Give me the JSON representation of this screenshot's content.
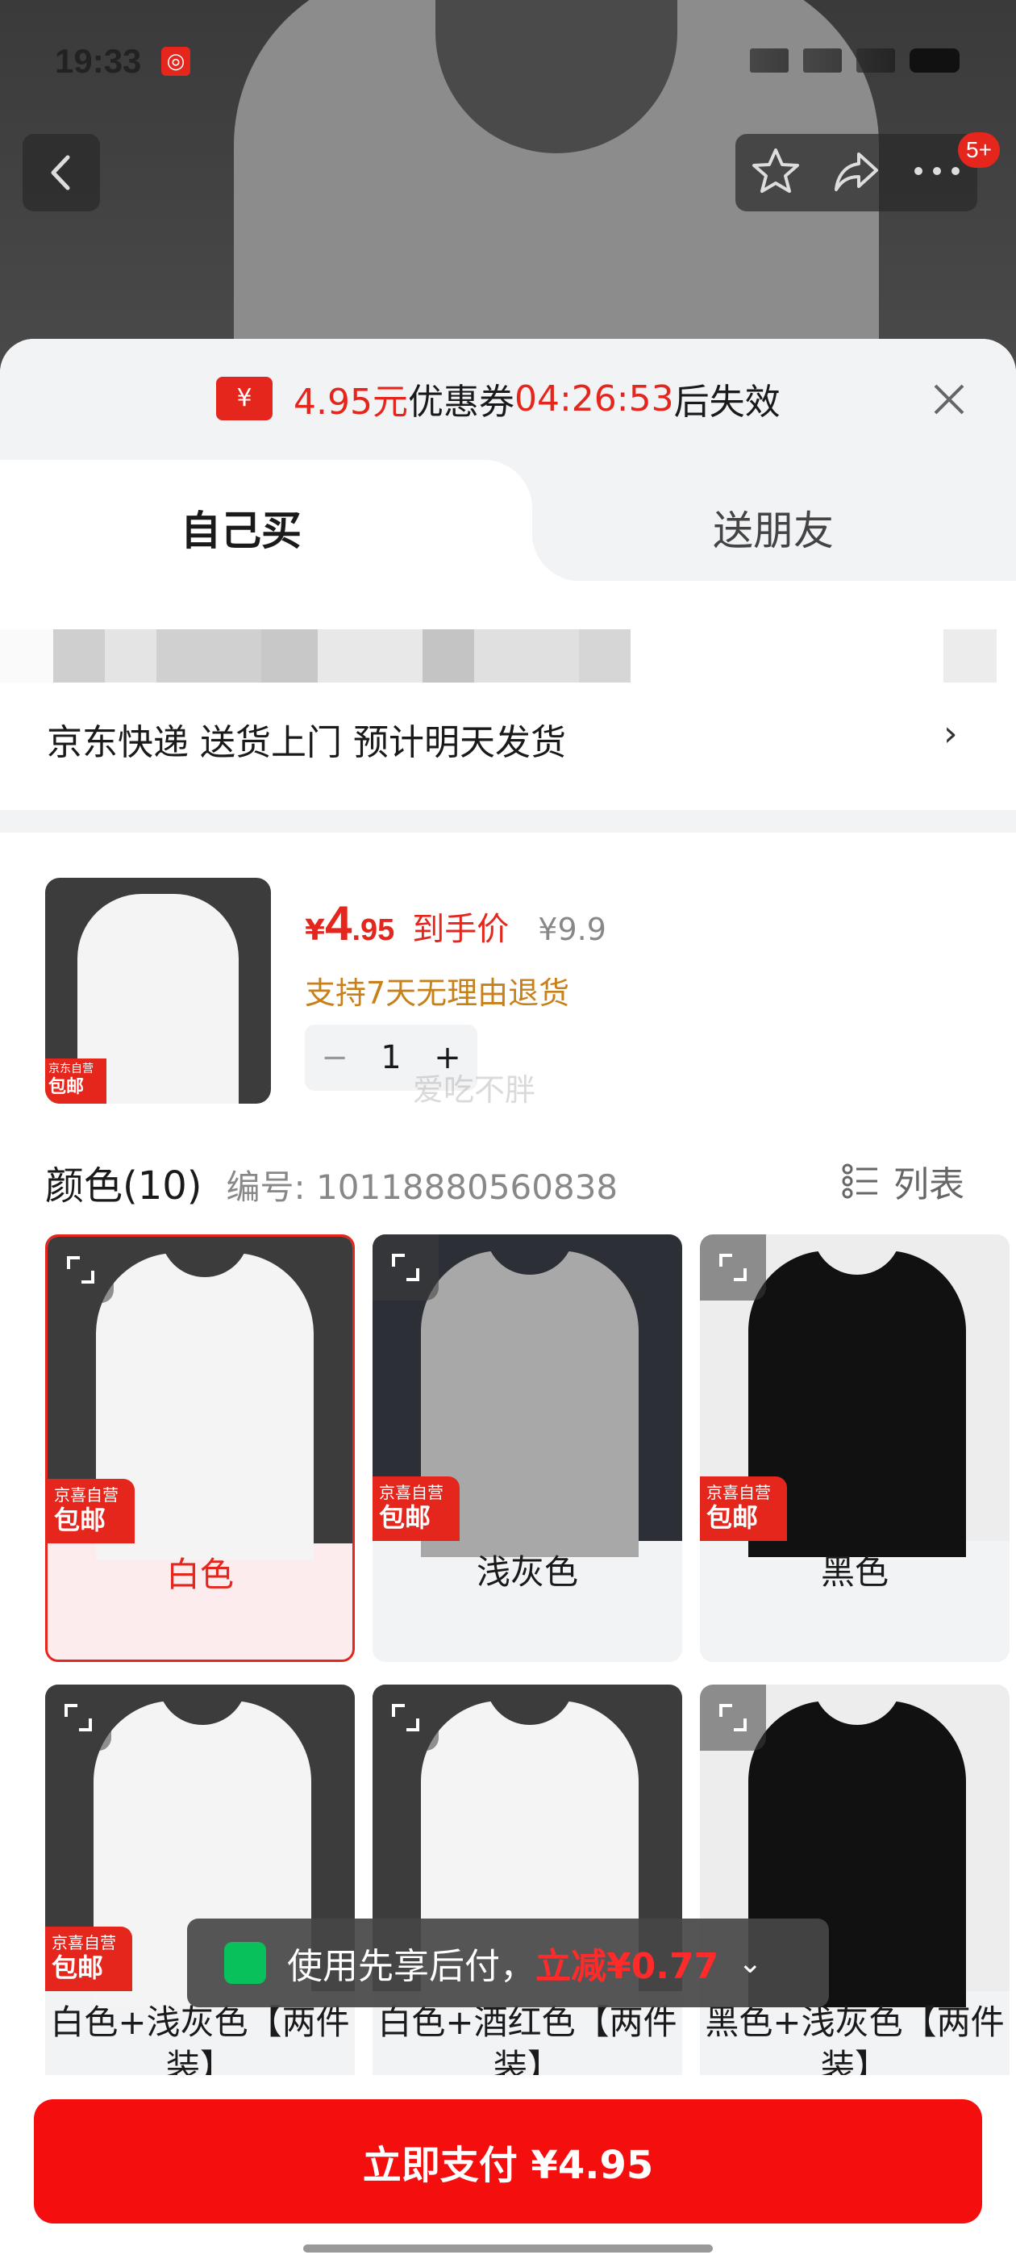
{
  "status_bar": {
    "time": "19:33",
    "app_icon": "netease-music-icon"
  },
  "header": {
    "back_icon": "chevron-left-icon",
    "fav_icon": "star-icon",
    "share_icon": "share-icon",
    "more_icon": "more-icon",
    "more_badge": "5+"
  },
  "coupon": {
    "amount": "4.95元",
    "label": "优惠券",
    "countdown": "04:26:53",
    "suffix": "后失效",
    "icon": "¥"
  },
  "tabs": [
    {
      "label": "自己买",
      "active": true
    },
    {
      "label": "送朋友",
      "active": false
    }
  ],
  "shipping": {
    "text": "京东快递 送货上门 预计明天发货",
    "arrow": "›"
  },
  "product": {
    "price_symbol": "¥",
    "price_int": "4",
    "price_dec": ".95",
    "price_tag": "到手价",
    "original_price": "¥9.9",
    "return_policy": "支持7天无理由退货",
    "quantity": "1",
    "minus": "−",
    "plus": "+",
    "badge_top": "京东自营",
    "badge_bottom": "包邮",
    "watermark": "爱吃不胖"
  },
  "color_section": {
    "title": "颜色(10)",
    "code": "编号: 10118880560838",
    "list_label": "列表"
  },
  "color_options": [
    {
      "label": "白色",
      "selected": true,
      "shirt": "#f4f4f4",
      "bg": "#3c3c3c",
      "badge_top": "京喜自营",
      "badge_bottom": "包邮"
    },
    {
      "label": "浅灰色",
      "selected": false,
      "shirt": "#a8a8a8",
      "bg": "#2c2f36",
      "badge_top": "京喜自营",
      "badge_bottom": "包邮"
    },
    {
      "label": "黑色",
      "selected": false,
      "shirt": "#111111",
      "bg": "#ededed",
      "badge_top": "京喜自营",
      "badge_bottom": "包邮"
    },
    {
      "label": "白色+浅灰色【两件装】",
      "selected": false,
      "shirt": "#f4f4f4",
      "bg": "#3c3c3c",
      "badge_top": "京喜自营",
      "badge_bottom": "包邮"
    },
    {
      "label": "白色+酒红色【两件装】",
      "selected": false,
      "shirt": "#f4f4f4",
      "bg": "#3c3c3c",
      "badge_top": "",
      "badge_bottom": ""
    },
    {
      "label": "黑色+浅灰色【两件装】",
      "selected": false,
      "shirt": "#111111",
      "bg": "#ededed",
      "badge_top": "",
      "badge_bottom": ""
    }
  ],
  "toast": {
    "text": "使用先享后付，",
    "highlight": "立减¥0.77"
  },
  "pay_button": {
    "label": "立即支付 ¥4.95"
  },
  "colors": {
    "accent": "#e4261d",
    "pay_button": "#f40e0e",
    "return_text": "#c8811a"
  }
}
